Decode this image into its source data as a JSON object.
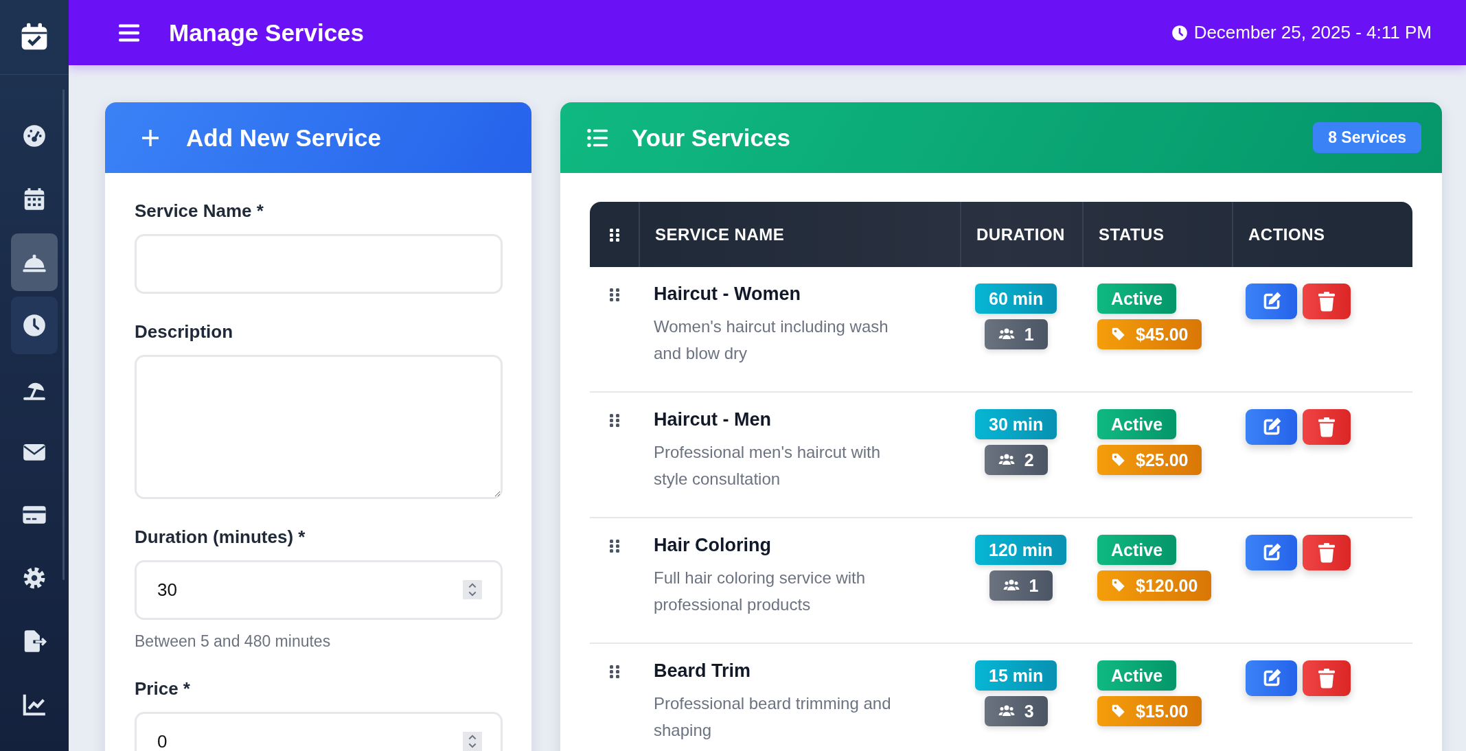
{
  "sidebar": {
    "items": [
      {
        "kind": "gauge",
        "selected": false,
        "hovered": false
      },
      {
        "kind": "calendar",
        "selected": false,
        "hovered": false
      },
      {
        "kind": "bell",
        "selected": true,
        "hovered": false
      },
      {
        "kind": "clock",
        "selected": false,
        "hovered": true
      },
      {
        "kind": "umbrella",
        "selected": false,
        "hovered": false
      },
      {
        "kind": "envelope",
        "selected": false,
        "hovered": false
      },
      {
        "kind": "card",
        "selected": false,
        "hovered": false
      },
      {
        "kind": "gear",
        "selected": false,
        "hovered": false
      },
      {
        "kind": "export",
        "selected": false,
        "hovered": false
      },
      {
        "kind": "chart",
        "selected": false,
        "hovered": false
      }
    ]
  },
  "header": {
    "title": "Manage Services",
    "datetime": "December 25, 2025 - 4:11 PM"
  },
  "add_form": {
    "title": "Add New Service",
    "fields": [
      {
        "kind": "text",
        "label": "Service Name *"
      },
      {
        "kind": "textarea",
        "label": "Description"
      },
      {
        "kind": "number",
        "label": "Duration (minutes) *",
        "value": "30",
        "hint": "Between 5 and 480 minutes"
      },
      {
        "kind": "number",
        "label": "Price *",
        "value": "0"
      }
    ]
  },
  "services": {
    "title": "Your Services",
    "count": "8 Services",
    "table": {
      "columns": [
        "SERVICE NAME",
        "DURATION",
        "STATUS",
        "ACTIONS"
      ],
      "rows": [
        {
          "name": "Haircut - Women",
          "description": "Women's haircut including wash and blow dry",
          "duration": "60 min",
          "staff": "1",
          "status": "Active",
          "price": "$45.00"
        },
        {
          "name": "Haircut - Men",
          "description": "Professional men's haircut with style consultation",
          "duration": "30 min",
          "staff": "2",
          "status": "Active",
          "price": "$25.00"
        },
        {
          "name": "Hair Coloring",
          "description": "Full hair coloring service with professional products",
          "duration": "120 min",
          "staff": "1",
          "status": "Active",
          "price": "$120.00"
        },
        {
          "name": "Beard Trim",
          "description": "Professional beard trimming and shaping",
          "duration": "15 min",
          "staff": "3",
          "status": "Active",
          "price": "$15.00"
        }
      ]
    }
  }
}
